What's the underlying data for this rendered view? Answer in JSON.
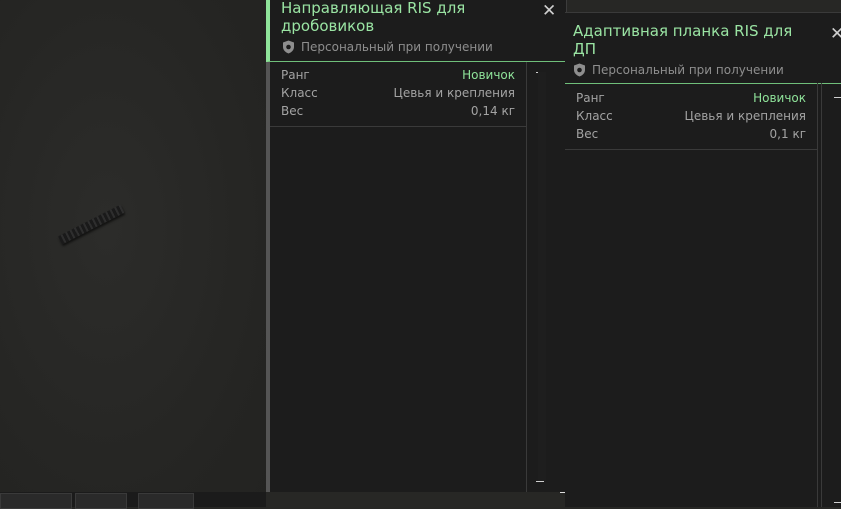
{
  "tooltips": [
    {
      "title": "Направляющая RIS для дробовиков",
      "personal": "Персональный при получении",
      "stats": [
        {
          "key": "Ранг",
          "value": "Новичок"
        },
        {
          "key": "Класс",
          "value": "Цевья и крепления"
        },
        {
          "key": "Вес",
          "value": "0,14 кг"
        }
      ]
    },
    {
      "title": "Адаптивная планка RIS для ДП",
      "personal": "Персональный при получении",
      "stats": [
        {
          "key": "Ранг",
          "value": "Новичок"
        },
        {
          "key": "Класс",
          "value": "Цевья и крепления"
        },
        {
          "key": "Вес",
          "value": "0,1 кг"
        }
      ]
    }
  ],
  "icons": {
    "close": "close-icon",
    "shield": "shield-icon",
    "collapse": "minus-icon"
  },
  "colors": {
    "accent": "#8fe39a",
    "background": "#1c1c1c",
    "text": "#a3a3a3"
  }
}
